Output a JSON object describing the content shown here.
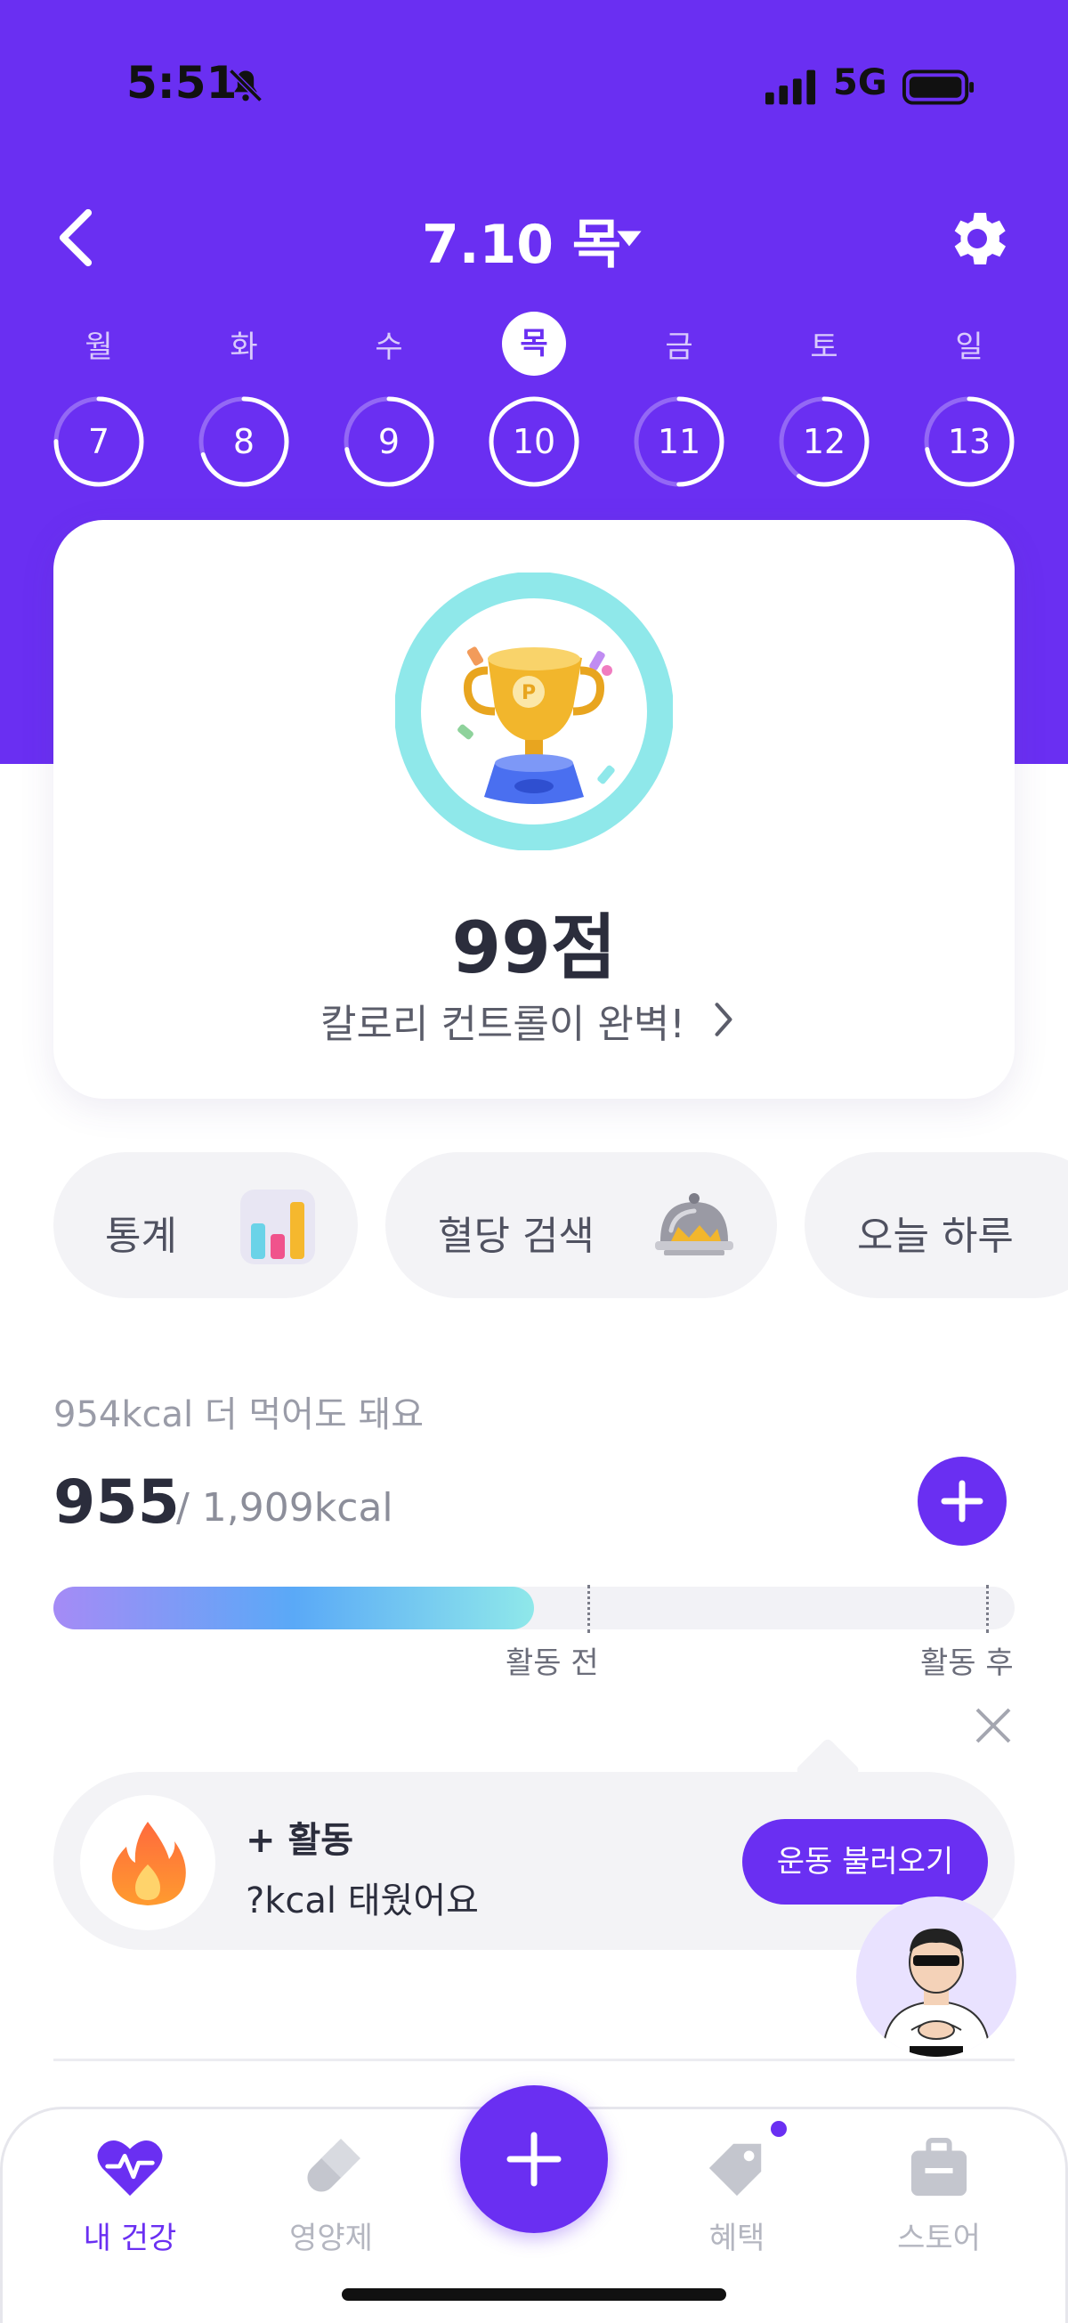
{
  "status_bar": {
    "time": "5:51",
    "network": "5G"
  },
  "header": {
    "date_title": "7.10 목"
  },
  "week": {
    "days": [
      {
        "weekday": "월",
        "date": "7",
        "active": false
      },
      {
        "weekday": "화",
        "date": "8",
        "active": false
      },
      {
        "weekday": "수",
        "date": "9",
        "active": false
      },
      {
        "weekday": "목",
        "date": "10",
        "active": true
      },
      {
        "weekday": "금",
        "date": "11",
        "active": false
      },
      {
        "weekday": "토",
        "date": "12",
        "active": false
      },
      {
        "weekday": "일",
        "date": "13",
        "active": false
      }
    ]
  },
  "score_card": {
    "score": "99점",
    "message": "칼로리 컨트롤이 완벽!"
  },
  "chips": [
    {
      "label": "통계",
      "icon": "bar-chart-icon"
    },
    {
      "label": "혈당 검색",
      "icon": "food-cloche-icon"
    },
    {
      "label": "오늘 하루",
      "icon": ""
    }
  ],
  "calories": {
    "hint": "954kcal 더 먹어도 돼요",
    "consumed": "955",
    "total": "/ 1,909kcal",
    "progress": 0.5,
    "marker_before": 0.5,
    "marker_after": 0.97,
    "label_before": "활동 전",
    "label_after": "활동 후"
  },
  "activity": {
    "title": "+ 활동",
    "subtitle": "?kcal 태웠어요",
    "button": "운동 불러오기"
  },
  "tabbar": {
    "items": [
      {
        "label": "내 건강",
        "icon": "heart-pulse-icon",
        "active": true
      },
      {
        "label": "영양제",
        "icon": "pill-icon",
        "active": false
      },
      {
        "label": "혜택",
        "icon": "tag-icon",
        "active": false
      },
      {
        "label": "스토어",
        "icon": "bag-icon",
        "active": false
      }
    ]
  },
  "colors": {
    "accent": "#6a2ff2",
    "ring": "#8fe8ea"
  }
}
